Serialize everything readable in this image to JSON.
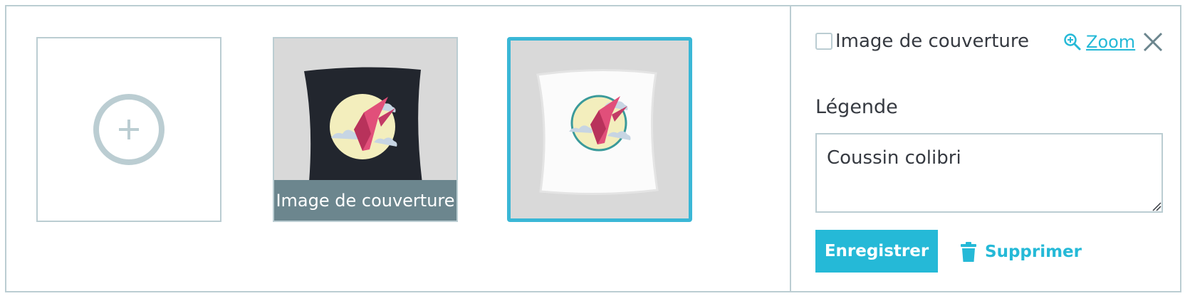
{
  "gallery": {
    "add_tile": {
      "icon": "plus-circle-icon"
    },
    "images": [
      {
        "product": "black pillow with hummingbird",
        "is_cover": true,
        "cover_label": "Image de couverture",
        "selected": false
      },
      {
        "product": "white pillow with hummingbird",
        "is_cover": false,
        "selected": true
      }
    ]
  },
  "details": {
    "cover_checkbox_label": "Image de couverture",
    "cover_checked": false,
    "zoom_label": "Zoom",
    "zoom_icon": "zoom-in-icon",
    "close_icon": "close-icon",
    "legend_label": "Légende",
    "caption_value": "Coussin colibri",
    "save_label": "Enregistrer",
    "delete_label": "Supprimer",
    "delete_icon": "trash-icon"
  },
  "colors": {
    "accent": "#25b9d7",
    "selected_border": "#3ab7d6",
    "border": "#bbcdd2",
    "cover_label_bg": "#6c868e",
    "text": "#363a41"
  }
}
